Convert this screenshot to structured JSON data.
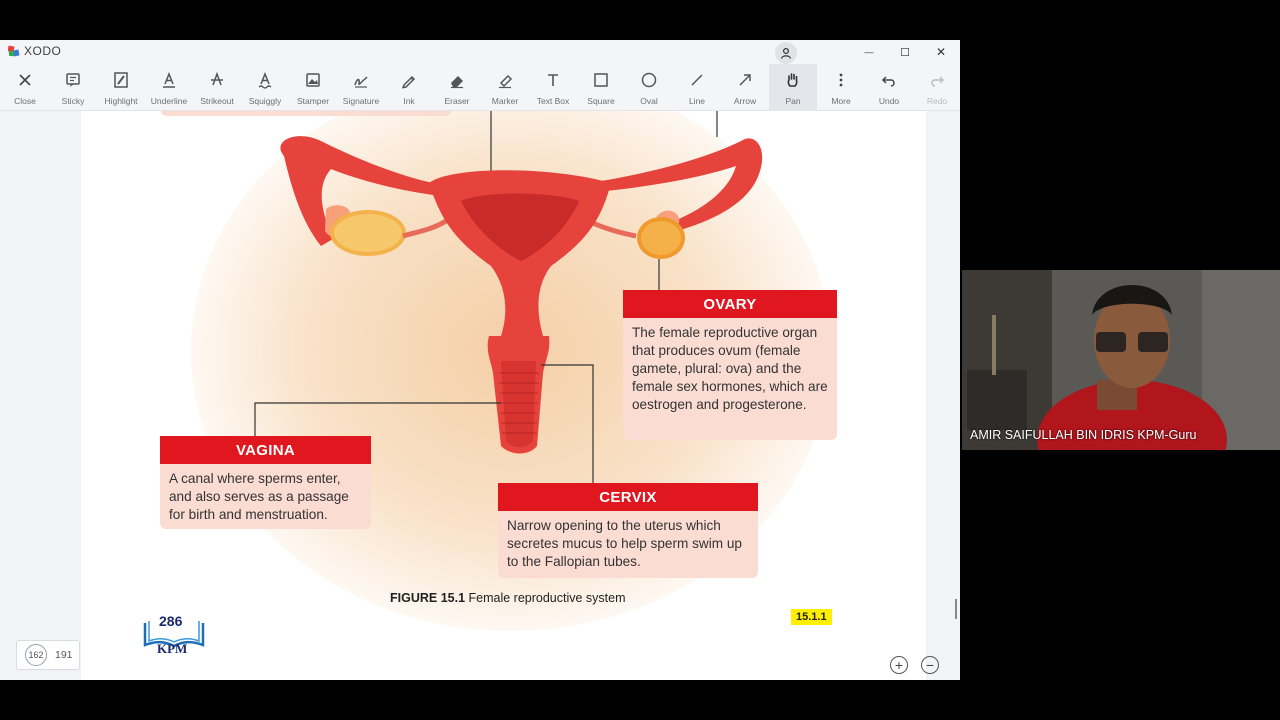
{
  "app": {
    "name": "XODO",
    "window_controls": {
      "minimize": "—",
      "maximize": "☐",
      "close": "✕"
    }
  },
  "toolbar": {
    "tools": [
      {
        "label": "Close",
        "icon": "close-icon"
      },
      {
        "label": "Sticky",
        "icon": "sticky-note-icon"
      },
      {
        "label": "Highlight",
        "icon": "highlight-icon"
      },
      {
        "label": "Underline",
        "icon": "underline-icon"
      },
      {
        "label": "Strikeout",
        "icon": "strikeout-icon"
      },
      {
        "label": "Squiggly",
        "icon": "squiggly-icon"
      },
      {
        "label": "Stamper",
        "icon": "stamp-icon"
      },
      {
        "label": "Signature",
        "icon": "signature-icon"
      },
      {
        "label": "Ink",
        "icon": "pen-icon"
      },
      {
        "label": "Eraser",
        "icon": "eraser-icon"
      },
      {
        "label": "Marker",
        "icon": "marker-icon"
      },
      {
        "label": "Text Box",
        "icon": "text-box-icon"
      },
      {
        "label": "Square",
        "icon": "square-icon"
      },
      {
        "label": "Oval",
        "icon": "oval-icon"
      },
      {
        "label": "Line",
        "icon": "line-icon"
      },
      {
        "label": "Arrow",
        "icon": "arrow-icon"
      },
      {
        "label": "Pan",
        "icon": "hand-icon",
        "active": true
      },
      {
        "label": "More",
        "icon": "more-vertical-icon"
      },
      {
        "label": "Undo",
        "icon": "undo-icon"
      },
      {
        "label": "Redo",
        "icon": "redo-icon",
        "disabled": true
      }
    ]
  },
  "document": {
    "callouts": {
      "ovary": {
        "title": "OVARY",
        "text": "The female reproductive organ that produces ovum (female gamete, plural: ova) and the female sex hormones, which are oestrogen and progesterone."
      },
      "vagina": {
        "title": "VAGINA",
        "text": "A canal where sperms enter, and also serves as a passage for birth and menstruation."
      },
      "cervix": {
        "title": "CERVIX",
        "text": "Narrow opening to the uterus which secretes mucus to help sperm swim up to the Fallopian tubes."
      }
    },
    "caption": {
      "label": "FIGURE 15.1",
      "text": "Female reproductive system"
    },
    "section_badge": "15.1.1",
    "page_number_printed": "286",
    "publisher": "KPM"
  },
  "navigation": {
    "current_page": "162",
    "total_pages": "191"
  },
  "webcam": {
    "participant_name": "AMIR SAIFULLAH BIN IDRIS KPM-Guru"
  },
  "colors": {
    "accent_red": "#e0171f",
    "callout_body": "#fbdcd3",
    "badge_yellow": "#ffef00"
  }
}
